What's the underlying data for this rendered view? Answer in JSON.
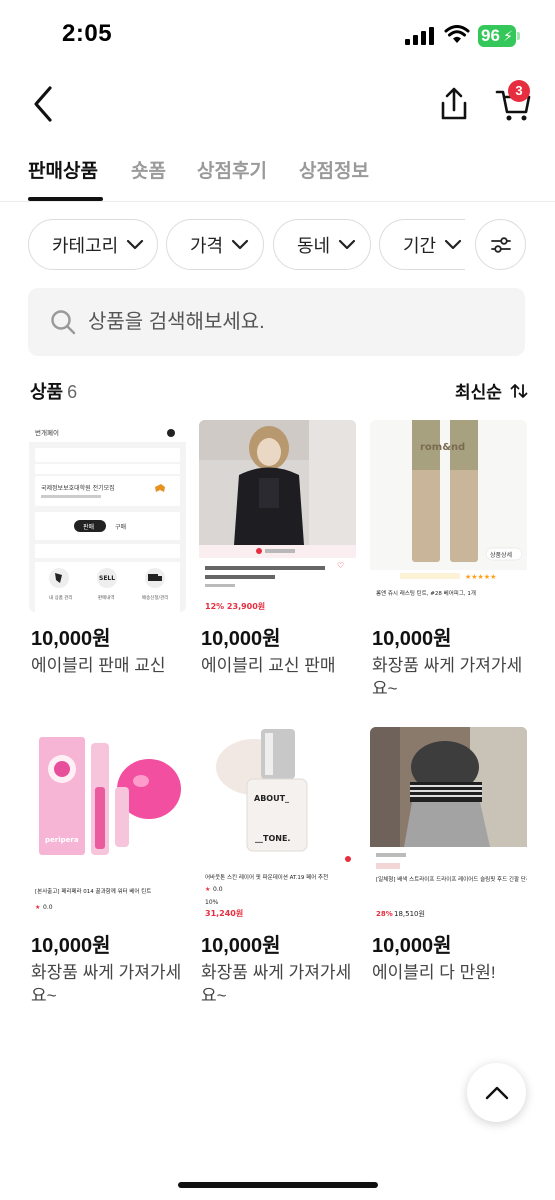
{
  "status_bar": {
    "time": "2:05",
    "battery": "96"
  },
  "header": {
    "cart_badge": "3"
  },
  "tabs": [
    {
      "label": "판매상품",
      "active": true
    },
    {
      "label": "숏폼",
      "active": false
    },
    {
      "label": "상점후기",
      "active": false
    },
    {
      "label": "상점정보",
      "active": false
    }
  ],
  "filters": [
    {
      "label": "카테고리"
    },
    {
      "label": "가격"
    },
    {
      "label": "동네"
    },
    {
      "label": "기간"
    }
  ],
  "search": {
    "placeholder": "상품을 검색해보세요."
  },
  "section": {
    "title": "상품",
    "count": "6",
    "sort_label": "최신순"
  },
  "products": [
    {
      "price": "10,000원",
      "name": "에이블리 판매 교신"
    },
    {
      "price": "10,000원",
      "name": "에이블리 교신 판매"
    },
    {
      "price": "10,000원",
      "name": "화장품 싸게 가져가세요~"
    },
    {
      "price": "10,000원",
      "name": "화장품 싸게 가져가세요~"
    },
    {
      "price": "10,000원",
      "name": "화장품 싸게 가져가세요~"
    },
    {
      "price": "10,000원",
      "name": "에이블리 다 만원!"
    }
  ],
  "thumbnails": {
    "t1": {
      "top_left": "번개페이",
      "cert_title": "국제정보보호대학원 전기모집",
      "sell_tab": "판매",
      "buy_tab": "구매",
      "sell_icon_text": "SELL",
      "menu1": "내 상품 관리",
      "menu2": "판매내역",
      "menu3": "배송신청/관리"
    },
    "t2": {
      "price_line": "12% 23,900원"
    },
    "t3": {
      "brand": "rom&nd",
      "label": "상품상세",
      "desc": "롬앤 쥬시 래스팅 틴트, #28 베어피그, 1개"
    },
    "t4": {
      "brand": "peripera",
      "desc": "[본사출고] 페리페라 014 꿀과함께 워터 베어 틴트",
      "rating": "0.0"
    },
    "t5": {
      "label_top": "ABOUT_",
      "label_bottom": "__TONE.",
      "desc": "어바웃톤 스킨 레이어 핏 파운데이션 AT.19 페어 추천",
      "rating": "0.0",
      "sale": "10%",
      "price": "31,240원"
    },
    "t6": {
      "desc": "[일체형] 배색 스트라이프 드라이프 레이어드 슬림핏 후드 긴팔 단추 이중 티셔츠",
      "sale": "28%",
      "price": "18,510원"
    }
  },
  "colors": {
    "accent": "#e62e3f",
    "battery": "#34c759"
  }
}
